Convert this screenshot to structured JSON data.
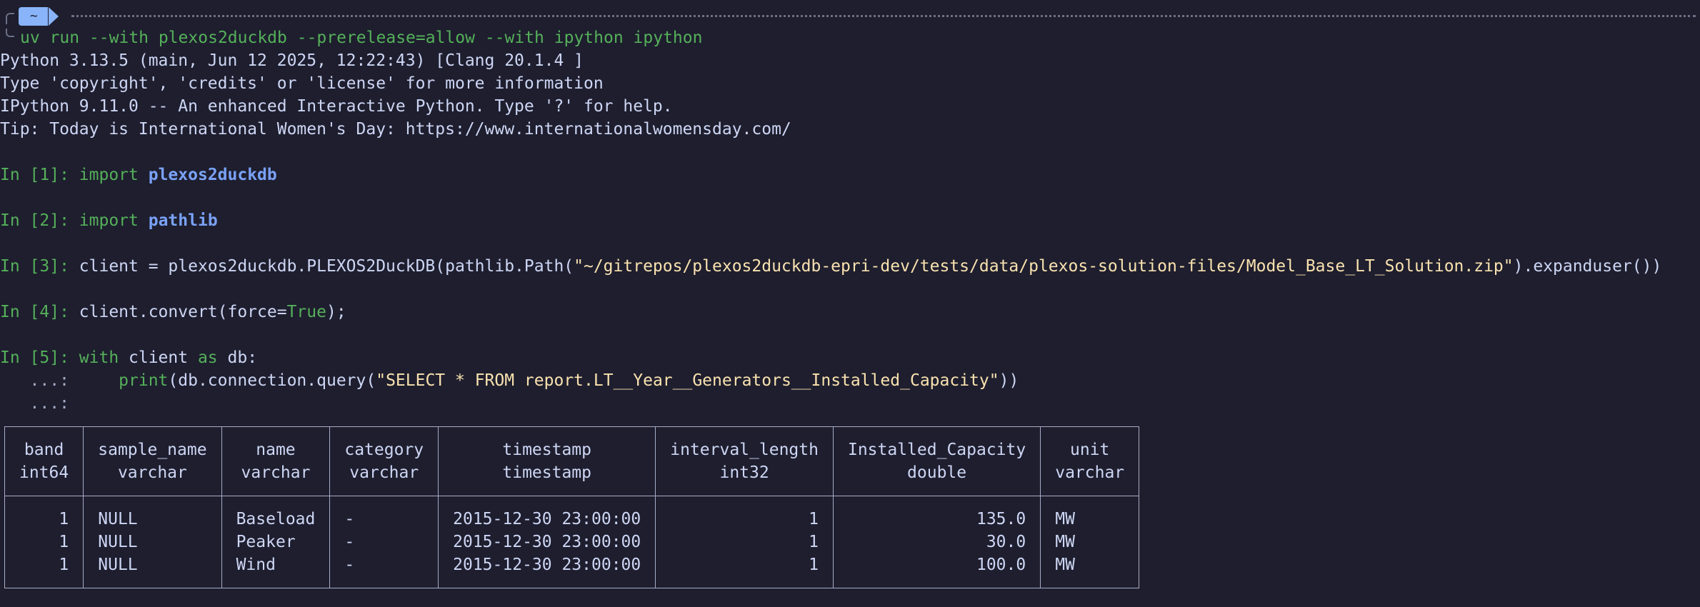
{
  "prompt": {
    "dir_label": "~",
    "command": "uv run --with plexos2duckdb --prerelease=allow --with ipython ipython"
  },
  "banner": [
    "Python 3.13.5 (main, Jun 12 2025, 12:22:43) [Clang 20.1.4 ]",
    "Type 'copyright', 'credits' or 'license' for more information",
    "IPython 9.11.0 -- An enhanced Interactive Python. Type '?' for help.",
    "Tip: Today is International Women's Day: https://www.internationalwomensday.com/"
  ],
  "cells": {
    "c1": {
      "prompt": "In [1]: ",
      "kw": "import",
      "mod": "plexos2duckdb"
    },
    "c2": {
      "prompt": "In [2]: ",
      "kw": "import",
      "mod": "pathlib"
    },
    "c3": {
      "prompt": "In [3]: ",
      "pre": "client = plexos2duckdb.PLEXOS2DuckDB(pathlib.Path(",
      "str": "\"~/gitrepos/plexos2duckdb-epri-dev/tests/data/plexos-solution-files/Model_Base_LT_Solution.zip\"",
      "post": ").expanduser())"
    },
    "c4": {
      "prompt": "In [4]: ",
      "pre": "client.convert(force=",
      "val": "True",
      "post": ");"
    },
    "c5": {
      "prompt": "In [5]: ",
      "kw_with": "with",
      "mid": " client ",
      "kw_as": "as",
      "end": " db:",
      "cont_prompt": "   ...: ",
      "indent": "    ",
      "fn": "print",
      "call_pre": "(db.connection.query(",
      "sql": "\"SELECT * FROM report.LT__Year__Generators__Installed_Capacity\"",
      "call_post": "))"
    }
  },
  "table": {
    "headers": [
      {
        "name": "band",
        "type": "int64"
      },
      {
        "name": "sample_name",
        "type": "varchar"
      },
      {
        "name": "name",
        "type": "varchar"
      },
      {
        "name": "category",
        "type": "varchar"
      },
      {
        "name": "timestamp",
        "type": "timestamp"
      },
      {
        "name": "interval_length",
        "type": "int32"
      },
      {
        "name": "Installed_Capacity",
        "type": "double"
      },
      {
        "name": "unit",
        "type": "varchar"
      }
    ],
    "rows": [
      [
        "1",
        "NULL",
        "Baseload",
        "-",
        "2015-12-30 23:00:00",
        "1",
        "135.0",
        "MW"
      ],
      [
        "1",
        "NULL",
        "Peaker",
        "-",
        "2015-12-30 23:00:00",
        "1",
        "30.0",
        "MW"
      ],
      [
        "1",
        "NULL",
        "Wind",
        "-",
        "2015-12-30 23:00:00",
        "1",
        "100.0",
        "MW"
      ]
    ]
  }
}
